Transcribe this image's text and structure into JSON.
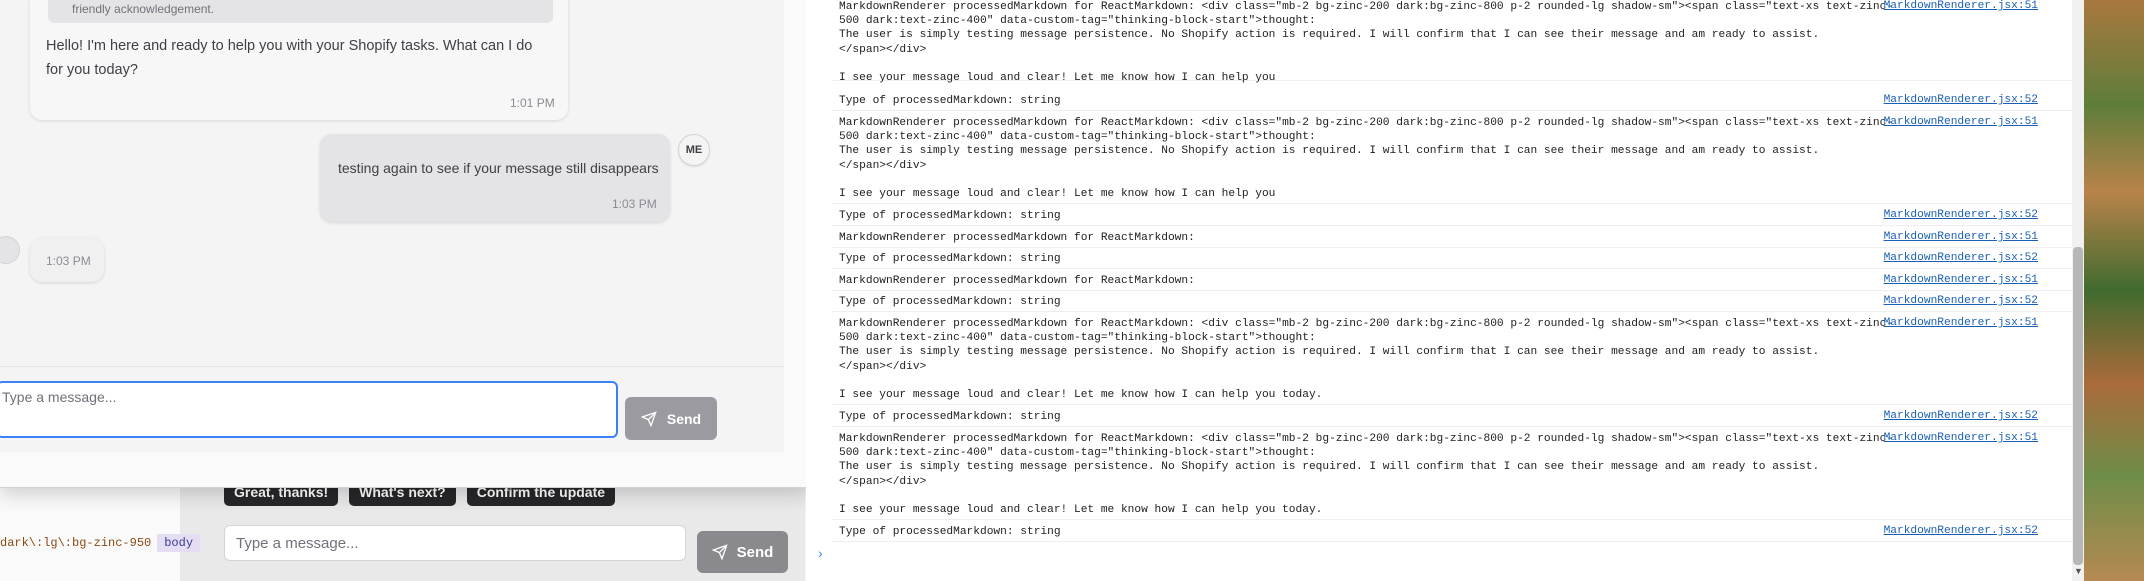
{
  "underlying": {
    "breadcrumb": [
      "dark\\:lg\\:bg-zinc-950",
      "body"
    ],
    "quick_replies": [
      "Great, thanks!",
      "What's next?",
      "Confirm the update"
    ],
    "input_placeholder": "Type a message...",
    "send_label": "Send"
  },
  "chat": {
    "thinking_snippet": "friendly acknowledgement.",
    "bot_message": "Hello! I'm here and ready to help you with your Shopify tasks. What can I do for you today?",
    "bot_time": "1:01 PM",
    "user_avatar": "ME",
    "user_message": "testing again to see if your message still disappears",
    "user_time": "1:03 PM",
    "bot2_time": "1:03 PM",
    "input_placeholder": "Type a message...",
    "send_label": "Send"
  },
  "console": {
    "logs": [
      {
        "text": "MarkdownRenderer processedMarkdown for ReactMarkdown: <div class=\"mb-2 bg-zinc-200 dark:bg-zinc-800 p-2 rounded-lg shadow-sm\"><span class=\"text-xs text-zinc-\n500 dark:text-zinc-400\" data-custom-tag=\"thinking-block-start\">thought:\nThe user is simply testing message persistence. No Shopify action is required. I will confirm that I can see their message and am ready to assist.\n</span></div>\n\nI see your message loud and clear! Let me know how I can help you",
        "src": "MarkdownRenderer.jsx:51"
      },
      {
        "text": "Type of processedMarkdown: string",
        "src": "MarkdownRenderer.jsx:52"
      },
      {
        "text": "MarkdownRenderer processedMarkdown for ReactMarkdown: <div class=\"mb-2 bg-zinc-200 dark:bg-zinc-800 p-2 rounded-lg shadow-sm\"><span class=\"text-xs text-zinc-\n500 dark:text-zinc-400\" data-custom-tag=\"thinking-block-start\">thought:\nThe user is simply testing message persistence. No Shopify action is required. I will confirm that I can see their message and am ready to assist.\n</span></div>\n\nI see your message loud and clear! Let me know how I can help you",
        "src": "MarkdownRenderer.jsx:51"
      },
      {
        "text": "Type of processedMarkdown: string",
        "src": "MarkdownRenderer.jsx:52"
      },
      {
        "text": "MarkdownRenderer processedMarkdown for ReactMarkdown:",
        "src": "MarkdownRenderer.jsx:51"
      },
      {
        "text": "Type of processedMarkdown: string",
        "src": "MarkdownRenderer.jsx:52"
      },
      {
        "text": "MarkdownRenderer processedMarkdown for ReactMarkdown:",
        "src": "MarkdownRenderer.jsx:51"
      },
      {
        "text": "Type of processedMarkdown: string",
        "src": "MarkdownRenderer.jsx:52"
      },
      {
        "text": "MarkdownRenderer processedMarkdown for ReactMarkdown: <div class=\"mb-2 bg-zinc-200 dark:bg-zinc-800 p-2 rounded-lg shadow-sm\"><span class=\"text-xs text-zinc-\n500 dark:text-zinc-400\" data-custom-tag=\"thinking-block-start\">thought:\nThe user is simply testing message persistence. No Shopify action is required. I will confirm that I can see their message and am ready to assist.\n</span></div>\n\nI see your message loud and clear! Let me know how I can help you today.",
        "src": "MarkdownRenderer.jsx:51"
      },
      {
        "text": "Type of processedMarkdown: string",
        "src": "MarkdownRenderer.jsx:52"
      },
      {
        "text": "MarkdownRenderer processedMarkdown for ReactMarkdown: <div class=\"mb-2 bg-zinc-200 dark:bg-zinc-800 p-2 rounded-lg shadow-sm\"><span class=\"text-xs text-zinc-\n500 dark:text-zinc-400\" data-custom-tag=\"thinking-block-start\">thought:\nThe user is simply testing message persistence. No Shopify action is required. I will confirm that I can see their message and am ready to assist.\n</span></div>\n\nI see your message loud and clear! Let me know how I can help you today.",
        "src": "MarkdownRenderer.jsx:51"
      },
      {
        "text": "Type of processedMarkdown: string",
        "src": "MarkdownRenderer.jsx:52"
      }
    ]
  },
  "colors": {
    "accent": "#3b82f6",
    "link": "#1a5fb4",
    "send_button": "#9a9aa0"
  }
}
